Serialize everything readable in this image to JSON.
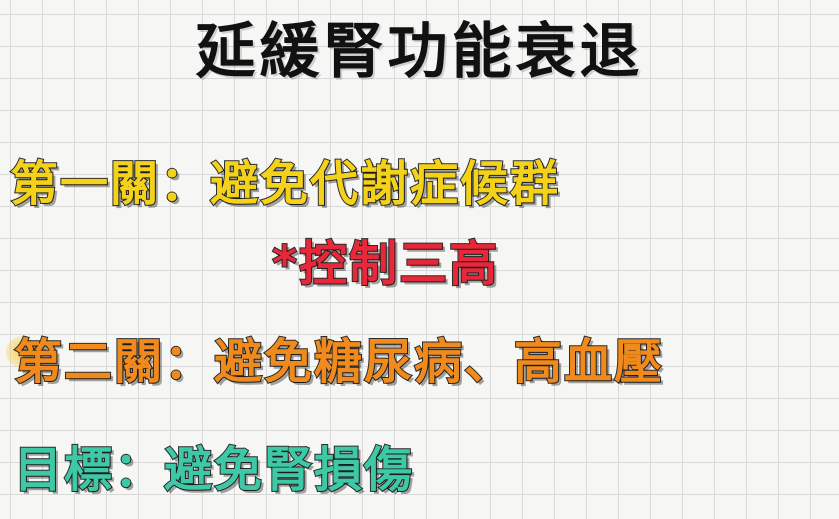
{
  "title": "延緩腎功能衰退",
  "lines": [
    {
      "text": "第一關：避免代謝症候群",
      "color": "#f4d21a"
    },
    {
      "text": "*控制三高",
      "color": "#e8283a"
    },
    {
      "text": "第二關：避免糖尿病、高血壓",
      "color": "#f08a1c"
    },
    {
      "text": "目標：避免腎損傷",
      "color": "#3ec9a6"
    }
  ]
}
